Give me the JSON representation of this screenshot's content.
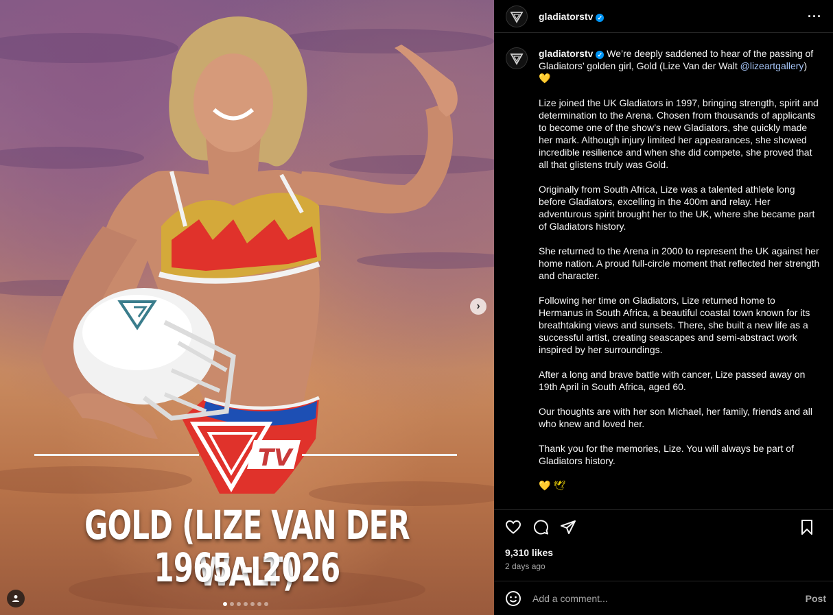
{
  "account": {
    "handle": "gladiatorstv",
    "verified_mark": "✓",
    "avatar_icon": "gladiators-logo-icon"
  },
  "media": {
    "tribute_name": "GOLD (LIZE VAN DER WALT)",
    "tribute_years": "1965 - 2026",
    "logo_label": "TV",
    "next_icon": "›",
    "slide_count": 7,
    "active_slide": 1
  },
  "caption": {
    "intro": "We’re deeply saddened to hear of the passing of Gladiators’ golden girl, Gold (Lize Van der Walt ",
    "mention": "@lizeartgallery",
    "intro_end": ")",
    "intro_emoji": "💛",
    "paragraphs": [
      "Lize joined the UK Gladiators in 1997, bringing strength, spirit and determination to the Arena. Chosen from thousands of applicants to become one of the show’s new Gladiators, she quickly made her mark. Although injury limited her appearances, she showed incredible resilience and when she did compete, she proved that all that glistens truly was Gold.",
      "Originally from South Africa, Lize was a talented athlete long before Gladiators, excelling in the 400m and relay. Her adventurous spirit brought her to the UK, where she became part of Gladiators history.",
      "She returned to the Arena in 2000 to represent the UK against her home nation. A proud full-circle moment that reflected her strength and character.",
      "Following her time on Gladiators, Lize returned home to Hermanus in South Africa, a beautiful coastal town known for its breathtaking views and sunsets. There, she built a new life as a successful artist, creating seascapes and semi-abstract work inspired by her surroundings.",
      "After a long and brave battle with cancer, Lize passed away on 19th April in South Africa, aged 60.",
      "Our thoughts are with her son Michael, her family, friends and all who knew and loved her.",
      "Thank you for the memories, Lize. You will always be part of Gladiators history."
    ],
    "closing_emojis": "💛 🕊"
  },
  "actions": {
    "like_icon": "heart-icon",
    "comment_icon": "comment-icon",
    "share_icon": "share-icon",
    "save_icon": "bookmark-icon"
  },
  "stats": {
    "likes": "9,310 likes",
    "posted": "2 days ago"
  },
  "comment": {
    "placeholder": "Add a comment...",
    "post_label": "Post",
    "emoji_icon": "smiley-icon"
  },
  "colors": {
    "background": "#000000",
    "link": "#a8c7fa",
    "verified": "#0095f6",
    "muted": "#a8a8a8"
  }
}
